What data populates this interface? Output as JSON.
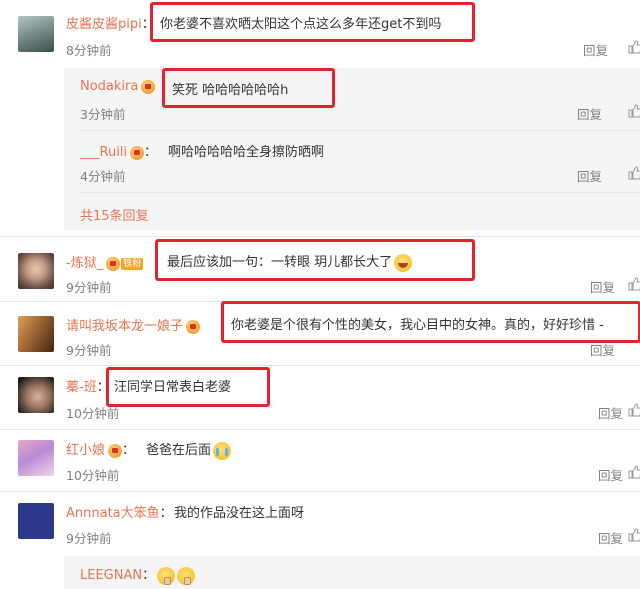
{
  "colors": {
    "name": "#eb7350",
    "text": "#333333",
    "meta": "#808080",
    "highlight": "#e0262a",
    "subpanel": "#f5f5f5"
  },
  "comments": [
    {
      "user": "皮酱皮酱pipi",
      "text": "你老婆不喜欢晒太阳这个点这么多年还get不到吗",
      "time": "8分钟前",
      "reply": "回复"
    },
    {
      "user": "-炼狱_",
      "tag": "铁粉",
      "text": "最后应该加一句：一转眼 玥儿都长大了",
      "time": "9分钟前",
      "reply": "回复"
    },
    {
      "user": "请叫我坂本龙一娘子",
      "text": "你老婆是个很有个性的美女，我心目中的女神。真的，好好珍惜 -",
      "time": "9分钟前",
      "reply": "回复"
    },
    {
      "user": "蓁-班",
      "text": "汪同学日常表白老婆",
      "time": "10分钟前",
      "reply": "回复"
    },
    {
      "user": "红小娘",
      "text": "爸爸在后面",
      "time": "10分钟前",
      "reply": "回复"
    },
    {
      "user": "Annnata大笨鱼",
      "text": "我的作品没在这上面呀",
      "time": "9分钟前",
      "reply": "回复"
    }
  ],
  "replies": [
    {
      "user": "Nodakira",
      "text": "笑死 哈哈哈哈哈哈h",
      "time": "3分钟前",
      "reply": "回复"
    },
    {
      "user": "___Ruili",
      "text": "啊哈哈哈哈哈全身擦防晒啊",
      "time": "4分钟前",
      "reply": "回复"
    }
  ],
  "more_replies": "共15条回复",
  "bottom_reply": {
    "user": "LEEGNAN"
  },
  "colon": "："
}
